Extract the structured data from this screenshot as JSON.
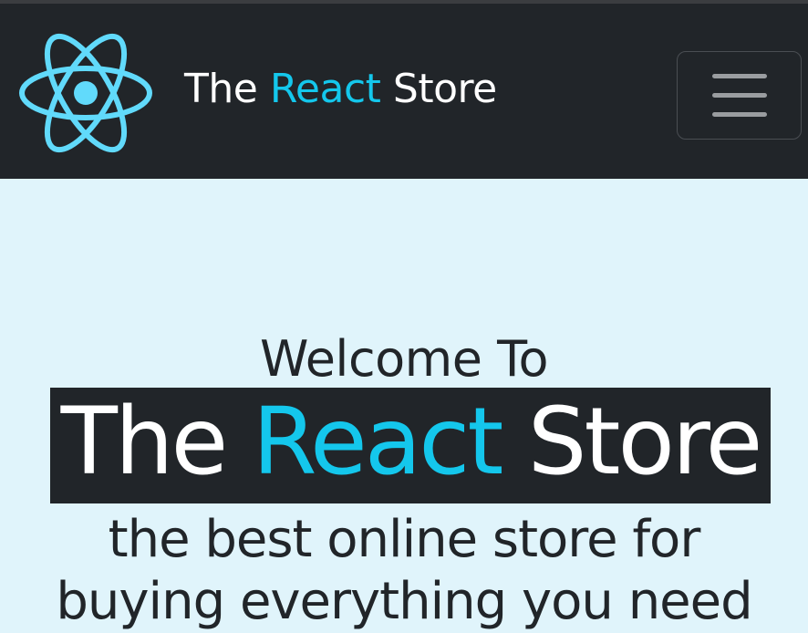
{
  "navbar": {
    "brand_part1": "The ",
    "brand_accent": "React",
    "brand_part2": " Store"
  },
  "hero": {
    "welcome": "Welcome To",
    "title_part1": "The ",
    "title_accent": "React",
    "title_part2": " Store",
    "tagline_line1": "the best online store for",
    "tagline_line2": "buying everything you need"
  },
  "colors": {
    "navbar_bg": "#212529",
    "accent": "#14c7ec",
    "hero_bg": "#e0f4fb",
    "logo": "#61dafb"
  },
  "icons": {
    "logo": "react-atom-logo",
    "menu": "hamburger-menu-icon"
  }
}
